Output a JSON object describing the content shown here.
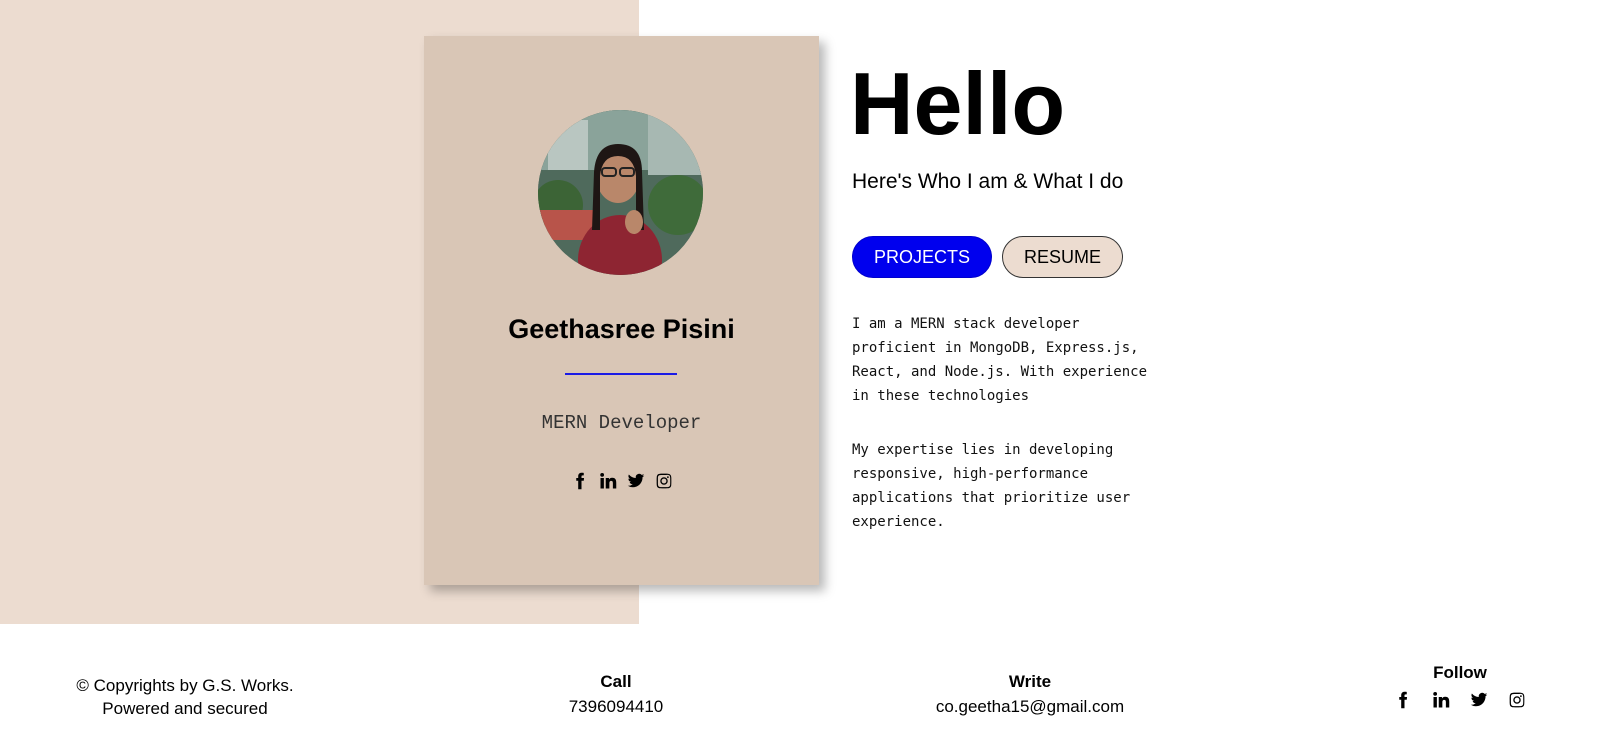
{
  "profile": {
    "name": "Geethasree Pisini",
    "role": "MERN Developer",
    "social_icons": [
      "facebook-icon",
      "linkedin-icon",
      "twitter-icon",
      "instagram-icon"
    ]
  },
  "hero": {
    "greeting": "Hello",
    "subtitle": "Here's Who I am & What I do",
    "buttons": {
      "projects": "PROJECTS",
      "resume": "RESUME"
    },
    "bio": [
      "I am a MERN stack developer proficient in MongoDB, Express.js, React, and Node.js. With experience in these technologies",
      "My expertise lies in developing responsive, high-performance applications that prioritize user experience."
    ]
  },
  "footer": {
    "copyright_line1": "© Copyrights by G.S. Works.",
    "copyright_line2": "Powered and secured",
    "call": {
      "heading": "Call",
      "value": "7396094410"
    },
    "write": {
      "heading": "Write",
      "value": "co.geetha15@gmail.com"
    },
    "follow": {
      "heading": "Follow"
    }
  },
  "colors": {
    "left_background": "#ecdcd0",
    "card_background": "#d9c6b6",
    "accent_blue": "#0000ee",
    "divider_blue": "#1a1ae6"
  }
}
